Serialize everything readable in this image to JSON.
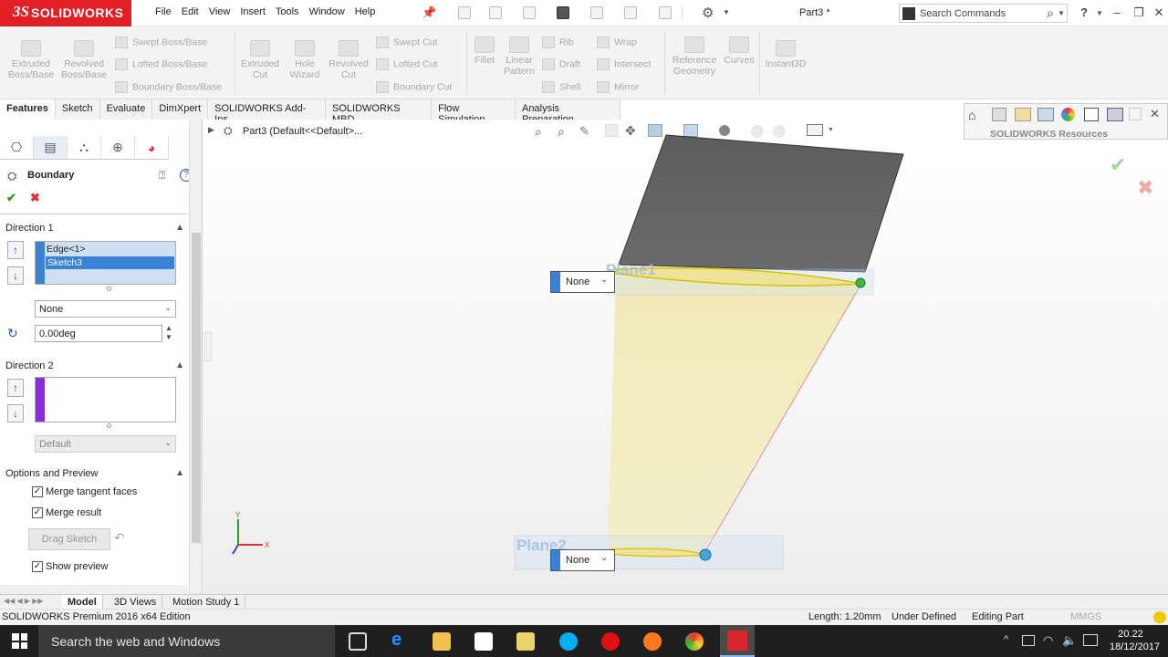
{
  "app": {
    "brand_prefix": "3S",
    "brand": "SOLIDWORKS",
    "document_title": "Part3 *"
  },
  "menus": [
    "File",
    "Edit",
    "View",
    "Insert",
    "Tools",
    "Window",
    "Help"
  ],
  "search": {
    "placeholder": "Search Commands",
    "help_label": "?"
  },
  "commands": {
    "extruded_boss": "Extruded Boss/Base",
    "revolved_boss": "Revolved Boss/Base",
    "swept_boss": "Swept Boss/Base",
    "lofted_boss": "Lofted Boss/Base",
    "boundary_boss": "Boundary Boss/Base",
    "extruded_cut": "Extruded Cut",
    "hole_wizard": "Hole Wizard",
    "revolved_cut": "Revolved Cut",
    "swept_cut": "Swept Cut",
    "lofted_cut": "Lofted Cut",
    "boundary_cut": "Boundary Cut",
    "fillet": "Fillet",
    "linear_pattern": "Linear Pattern",
    "rib": "Rib",
    "draft": "Draft",
    "shell": "Shell",
    "wrap": "Wrap",
    "intersect": "Intersect",
    "mirror": "Mirror",
    "reference_geometry": "Reference Geometry",
    "curves": "Curves",
    "instant3d": "Instant3D"
  },
  "tabs": [
    "Features",
    "Sketch",
    "Evaluate",
    "DimXpert",
    "SOLIDWORKS Add-Ins",
    "SOLIDWORKS MBD",
    "Flow Simulation",
    "Analysis Preparation"
  ],
  "property_manager": {
    "title": "Boundary",
    "direction1": {
      "label": "Direction 1",
      "items": [
        "Edge<1>",
        "Sketch3"
      ],
      "tangency": "None",
      "angle": "0.00deg"
    },
    "direction2": {
      "label": "Direction 2",
      "tangency": "Default"
    },
    "options": {
      "label": "Options and Preview",
      "merge_tangent": "Merge tangent faces",
      "merge_result": "Merge result",
      "drag_sketch": "Drag Sketch",
      "show_preview": "Show preview",
      "merge_tangent_checked": true,
      "merge_result_checked": true,
      "show_preview_checked": true
    }
  },
  "feature_tree": {
    "breadcrumb": "Part3  (Default<<Default>..."
  },
  "viewport": {
    "plane1_label": "Plane1",
    "plane2_label": "Plane2",
    "tangency1": "None",
    "tangency2": "None",
    "resources_label": "SOLIDWORKS Resources"
  },
  "bottom_tabs": [
    "Model",
    "3D Views",
    "Motion Study 1"
  ],
  "status": {
    "edition": "SOLIDWORKS Premium 2016 x64 Edition",
    "length": "Length: 1.20mm",
    "definition": "Under Defined",
    "mode": "Editing Part",
    "units": "MMGS"
  },
  "taskbar": {
    "search_placeholder": "Search the web and Windows",
    "time": "20.22",
    "date": "18/12/2017"
  }
}
